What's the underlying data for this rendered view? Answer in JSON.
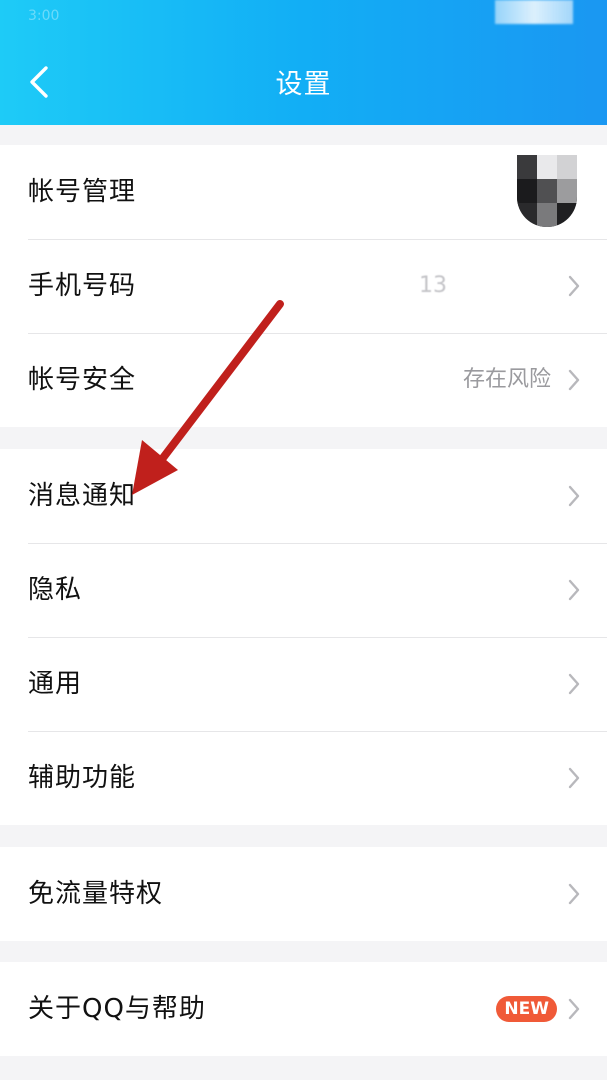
{
  "status_bar": {
    "time": "3:00"
  },
  "header": {
    "title": "设置"
  },
  "groups": [
    {
      "items": [
        {
          "label": "帐号管理"
        },
        {
          "label": "手机号码",
          "value": "13"
        },
        {
          "label": "帐号安全",
          "value": "存在风险"
        }
      ]
    },
    {
      "items": [
        {
          "label": "消息通知"
        },
        {
          "label": "隐私"
        },
        {
          "label": "通用"
        },
        {
          "label": "辅助功能"
        }
      ]
    },
    {
      "items": [
        {
          "label": "免流量特权"
        }
      ]
    },
    {
      "items": [
        {
          "label": "关于QQ与帮助",
          "badge": "NEW"
        }
      ]
    }
  ],
  "colors": {
    "header_start": "#1ecbf7",
    "header_end": "#1a97f2",
    "badge": "#f05a38",
    "annotation_arrow": "#c0201c"
  },
  "icons": [
    "back-arrow-icon",
    "chevron-right-icon",
    "avatar",
    "annotation-arrow"
  ]
}
